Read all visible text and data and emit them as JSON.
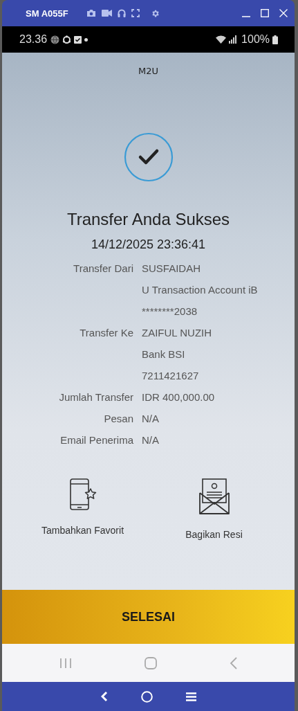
{
  "window": {
    "title": "SM A055F"
  },
  "status_bar": {
    "time": "23.36",
    "battery": "100%"
  },
  "app": {
    "title": "M2U",
    "heading": "Transfer Anda Sukses",
    "datetime": "14/12/2025 23:36:41",
    "details": [
      {
        "label": "Transfer Dari",
        "values": [
          "SUSFAIDAH",
          "U Transaction Account iB",
          "********2038"
        ]
      },
      {
        "label": "Transfer Ke",
        "values": [
          "ZAIFUL NUZIH",
          "Bank BSI",
          "7211421627"
        ]
      },
      {
        "label": "Jumlah Transfer",
        "values": [
          "IDR 400,000.00"
        ]
      },
      {
        "label": "Pesan",
        "values": [
          "N/A"
        ]
      },
      {
        "label": "Email Penerima",
        "values": [
          "N/A"
        ]
      }
    ],
    "actions": [
      {
        "kind": "favorite",
        "label": "Tambahkan Favorit"
      },
      {
        "kind": "share",
        "label": "Bagikan Resi"
      }
    ],
    "done_button": "SELESAI"
  }
}
